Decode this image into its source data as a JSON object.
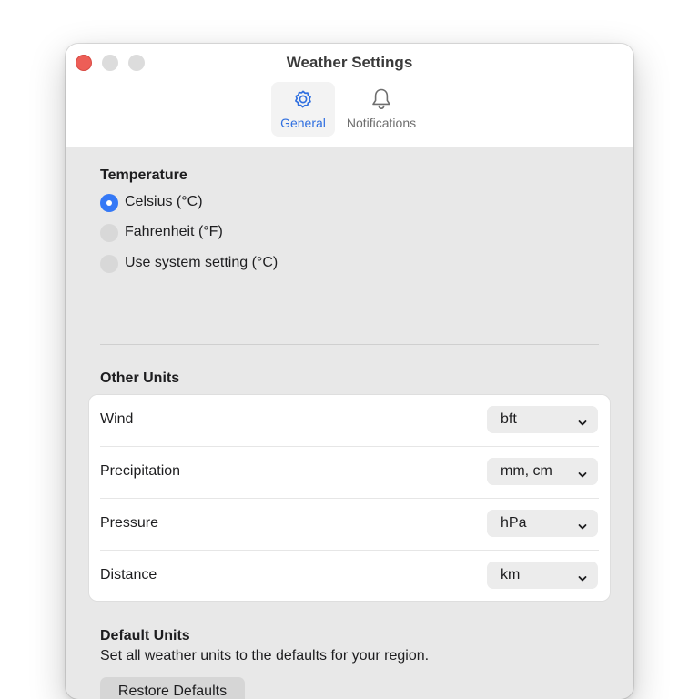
{
  "window": {
    "title": "Weather Settings"
  },
  "toolbar": {
    "tabs": [
      {
        "label": "General",
        "icon": "gear-icon",
        "selected": true
      },
      {
        "label": "Notifications",
        "icon": "bell-icon",
        "selected": false
      }
    ]
  },
  "temperature": {
    "heading": "Temperature",
    "options": [
      {
        "label": "Celsius (°C)",
        "selected": true
      },
      {
        "label": "Fahrenheit (°F)",
        "selected": false
      },
      {
        "label": "Use system setting (°C)",
        "selected": false
      }
    ]
  },
  "other_units": {
    "heading": "Other Units",
    "rows": [
      {
        "label": "Wind",
        "value": "bft"
      },
      {
        "label": "Precipitation",
        "value": "mm, cm"
      },
      {
        "label": "Pressure",
        "value": "hPa"
      },
      {
        "label": "Distance",
        "value": "km"
      }
    ]
  },
  "default_units": {
    "heading": "Default Units",
    "description": "Set all weather units to the defaults for your region.",
    "button_label": "Restore Defaults"
  },
  "colors": {
    "accent": "#3478f6",
    "tab_selected_text": "#2f6fe0",
    "close_button": "#ed5e57"
  }
}
